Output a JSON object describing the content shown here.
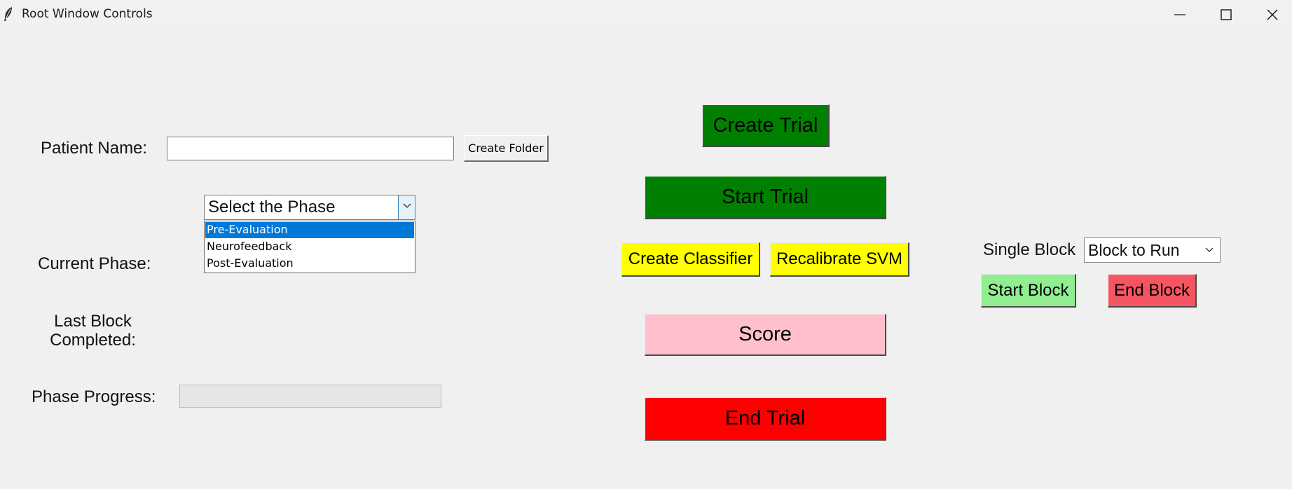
{
  "window": {
    "title": "Root Window Controls",
    "icon": "feather-icon"
  },
  "patient": {
    "label": "Patient Name:",
    "value": "",
    "create_folder_label": "Create Folder"
  },
  "phase": {
    "label": "Current Phase:",
    "combo_value": "Select the Phase",
    "options": [
      "Pre-Evaluation",
      "Neurofeedback",
      "Post-Evaluation"
    ],
    "highlighted_option": "Pre-Evaluation"
  },
  "last_block": {
    "label_line1": "Last Block",
    "label_line2": "Completed:",
    "value": ""
  },
  "progress": {
    "label": "Phase Progress:",
    "percent": 0
  },
  "trial_controls": {
    "create_trial": "Create Trial",
    "start_trial": "Start Trial",
    "create_classifier": "Create Classifier",
    "recalibrate_svm": "Recalibrate SVM",
    "score": "Score",
    "end_trial": "End Trial"
  },
  "single_block": {
    "label": "Single Block",
    "combo_value": "Block to Run",
    "start_label": "Start Block",
    "end_label": "End Block"
  },
  "colors": {
    "dark_green": "#008000",
    "yellow": "#ffff00",
    "pink": "#ffc0cb",
    "red": "#ff0000",
    "light_green": "#90ee90",
    "light_red": "#f55563",
    "selection_blue": "#0078d7"
  }
}
